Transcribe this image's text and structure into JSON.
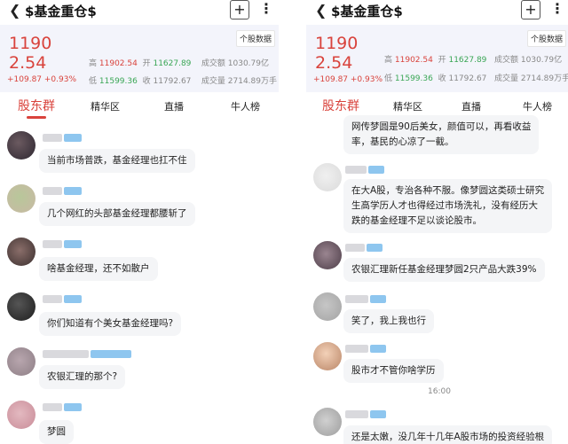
{
  "header": {
    "title": "$基金重仓$",
    "back_icon": "chevron-left-icon",
    "plus_label": "+",
    "more_icon": "more-vertical-icon"
  },
  "quote": {
    "price": "11902.54",
    "change": "+109.87 +0.93%",
    "stock_data_button": "个股数据",
    "high_label": "高",
    "high_value": "11902.54",
    "open_label": "开",
    "open_value": "11627.89",
    "turnover_label": "成交额",
    "turnover_value": "1030.79亿",
    "low_label": "低",
    "low_value": "11599.36",
    "close_label": "收",
    "close_value": "11792.67",
    "volume_label": "成交量",
    "volume_value": "2714.89万手"
  },
  "tabs": [
    "股东群",
    "精华区",
    "直播",
    "牛人榜"
  ],
  "colors": {
    "accent": "#d9433c",
    "rise": "#d9433c",
    "fall": "#3aa655",
    "bubble": "#f4f5f7"
  },
  "left_messages": [
    {
      "text": "当前市场普跌，基金经理也扛不住"
    },
    {
      "text": "几个网红的头部基金经理都腰斩了"
    },
    {
      "text": "啥基金经理，还不如散户"
    },
    {
      "text": "你们知道有个美女基金经理吗?"
    },
    {
      "text": "农银汇理的那个?"
    },
    {
      "text": "梦圆"
    }
  ],
  "right_messages": [
    {
      "lines": [
        "网传梦圆是90后美女，颜值可以，再看收益",
        "率，基民的心凉了一截。"
      ]
    },
    {
      "lines": [
        "在大A股，专治各种不服。像梦圆这类硕士研究",
        "生高学历人才也得经过市场洗礼，没有经历大",
        "跌的基金经理不足以谈论股市。"
      ]
    },
    {
      "lines": [
        "农银汇理新任基金经理梦圆2只产品大跌39%"
      ]
    },
    {
      "lines": [
        "笑了，我上我也行"
      ]
    },
    {
      "lines": [
        "股市才不管你啥学历"
      ]
    },
    {
      "lines": [
        "还是太嫩，没几年十几年A股市场的投资经验根"
      ]
    }
  ],
  "time_divider": "16:00"
}
